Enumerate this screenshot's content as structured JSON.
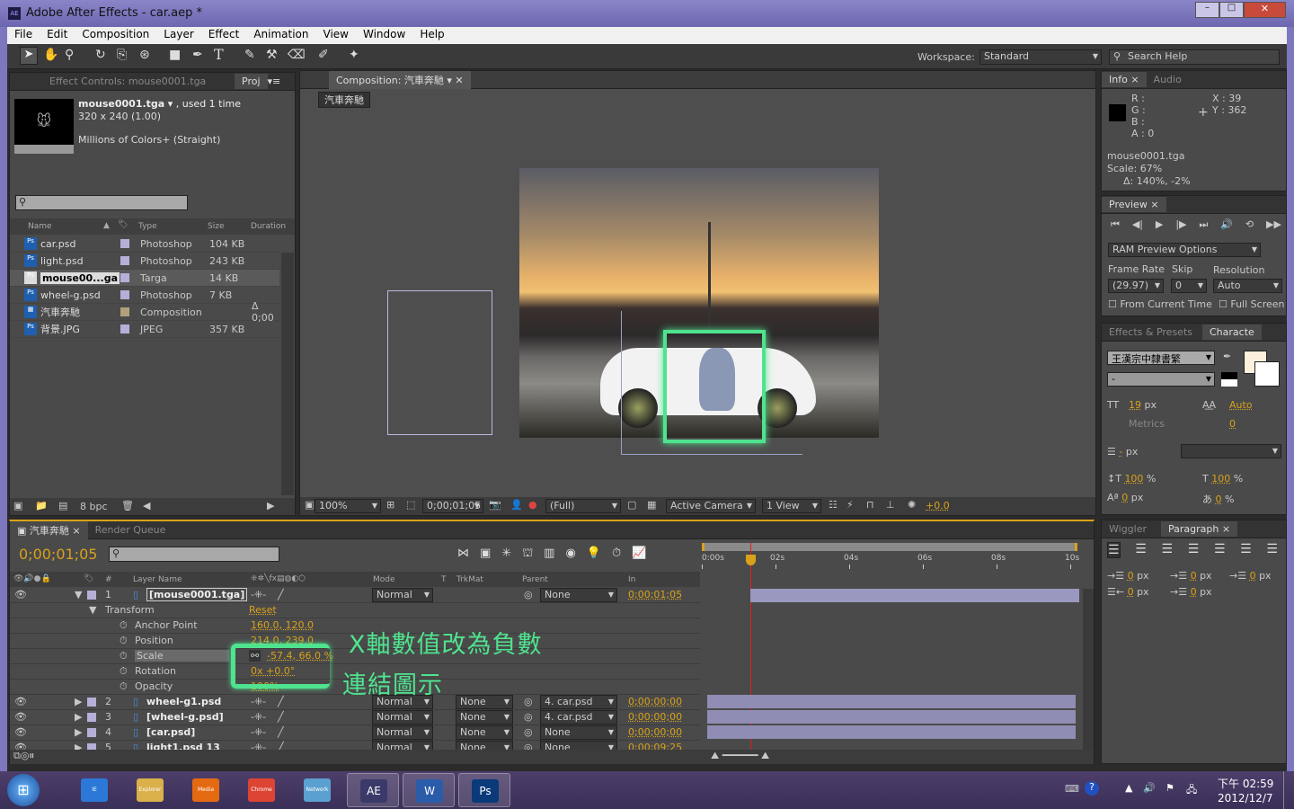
{
  "window": {
    "title": "Adobe After Effects - car.aep *",
    "app_icon": "AE"
  },
  "menu": [
    "File",
    "Edit",
    "Composition",
    "Layer",
    "Effect",
    "Animation",
    "View",
    "Window",
    "Help"
  ],
  "toolbar": {
    "workspace_label": "Workspace:",
    "workspace_value": "Standard",
    "search_placeholder": "Search Help"
  },
  "project": {
    "tab_effect": "Effect Controls: mouse0001.tga",
    "tab_project": "Proj",
    "item_name": "mouse0001.tga",
    "item_used": ", used 1 time",
    "item_dims": "320 x 240 (1.00)",
    "item_colors": "Millions of Colors+ (Straight)",
    "columns": [
      "Name",
      "Type",
      "Size",
      "Duration"
    ],
    "items": [
      {
        "name": "car.psd",
        "type": "Photoshop",
        "size": "104 KB",
        "duration": "",
        "label": "#b4b0d8"
      },
      {
        "name": "light.psd",
        "type": "Photoshop",
        "size": "243 KB",
        "duration": "",
        "label": "#b4b0d8"
      },
      {
        "name": "mouse00...ga",
        "type": "Targa",
        "size": "14 KB",
        "duration": "",
        "label": "#b4b0d8"
      },
      {
        "name": "wheel-g.psd",
        "type": "Photoshop",
        "size": "7 KB",
        "duration": "",
        "label": "#b4b0d8"
      },
      {
        "name": "汽車奔馳",
        "type": "Composition",
        "size": "",
        "duration": "Δ 0;00",
        "label": "#b0a07c"
      },
      {
        "name": "背景.JPG",
        "type": "JPEG",
        "size": "357 KB",
        "duration": "",
        "label": "#b4b0d8"
      }
    ],
    "bpc": "8 bpc"
  },
  "composition": {
    "tab": "Composition: 汽車奔馳",
    "breadcrumb": "汽車奔馳",
    "zoom": "100%",
    "timecode": "0;00;01;05",
    "resolution": "(Full)",
    "camera": "Active Camera",
    "views": "1 View",
    "exposure": "+0.0"
  },
  "info": {
    "tab": "Info",
    "tab2": "Audio",
    "r": "R :",
    "g": "G :",
    "b": "B :",
    "a": "A : 0",
    "x": "X : 39",
    "y": "Y : 362",
    "file": "mouse0001.tga",
    "scale": "Scale: 67%",
    "delta": "Δ: 140%, -2%"
  },
  "preview": {
    "tab": "Preview",
    "ram": "RAM Preview Options",
    "frame_rate_label": "Frame Rate",
    "skip_label": "Skip",
    "resolution_label": "Resolution",
    "frame_rate": "(29.97)",
    "skip": "0",
    "resolution": "Auto",
    "from_current": "From Current Time",
    "full_screen": "Full Screen"
  },
  "character": {
    "tab1": "Effects & Presets",
    "tab2": "Characte",
    "font": "王漢宗中隸書繁",
    "style": "-",
    "size": "19",
    "size_unit": " px",
    "leading": "Auto",
    "kerning": "Metrics",
    "tracking": "0",
    "stroke": "-",
    "stroke_unit": " px",
    "vscale": "100",
    "hscale": "100",
    "pct": " %",
    "baseline": "0",
    "baseline_unit": " px",
    "tsume": "0",
    "fill_color": "#fdf0dc"
  },
  "paragraph": {
    "tab1": "Wiggler",
    "tab2": "Paragraph",
    "indent": [
      "0",
      "0",
      "0",
      "0",
      "0"
    ],
    "unit": " px"
  },
  "timeline": {
    "tab": "汽車奔馳",
    "tab2": "Render Queue",
    "timecode": "0;00;01;05",
    "columns": {
      "name": "Layer Name",
      "num": "#",
      "mode": "Mode",
      "t": "T",
      "trkmat": "TrkMat",
      "parent": "Parent",
      "in": "In"
    },
    "ruler": [
      "0:00s",
      "02s",
      "04s",
      "06s",
      "08s",
      "10s"
    ],
    "layer1": {
      "num": "1",
      "name": "[mouse0001.tga]",
      "mode": "Normal",
      "parent": "None",
      "in": "0;00;01;05"
    },
    "transform": {
      "label": "Transform",
      "reset": "Reset",
      "props": [
        {
          "name": "Anchor Point",
          "value": "160.0, 120.0"
        },
        {
          "name": "Position",
          "value": "214.0, 239.0"
        },
        {
          "name": "Scale",
          "value": "-57.4, 66.0 %"
        },
        {
          "name": "Rotation",
          "value": "0x +0.0°"
        },
        {
          "name": "Opacity",
          "value": "100%"
        }
      ]
    },
    "layers": [
      {
        "num": "2",
        "name": "wheel-g1.psd",
        "mode": "Normal",
        "trkmat": "None",
        "parent": "4. car.psd",
        "in": "0;00;00;00"
      },
      {
        "num": "3",
        "name": "[wheel-g.psd]",
        "mode": "Normal",
        "trkmat": "None",
        "parent": "4. car.psd",
        "in": "0;00;00;00"
      },
      {
        "num": "4",
        "name": "[car.psd]",
        "mode": "Normal",
        "trkmat": "None",
        "parent": "None",
        "in": "0;00;00;00"
      },
      {
        "num": "5",
        "name": "light1.psd 13",
        "mode": "Normal",
        "trkmat": "None",
        "parent": "None",
        "in": "0;00;09;25"
      }
    ]
  },
  "annotations": {
    "line1": "X軸數值改為負數",
    "line2": "連結圖示",
    "color": "#4fe38f"
  },
  "taskbar": {
    "apps": [
      "IE",
      "Explorer",
      "Media Player",
      "Chrome",
      "Network",
      "AE",
      "W",
      "Ps"
    ],
    "time": "下午 02:59",
    "date": "2012/12/7"
  }
}
